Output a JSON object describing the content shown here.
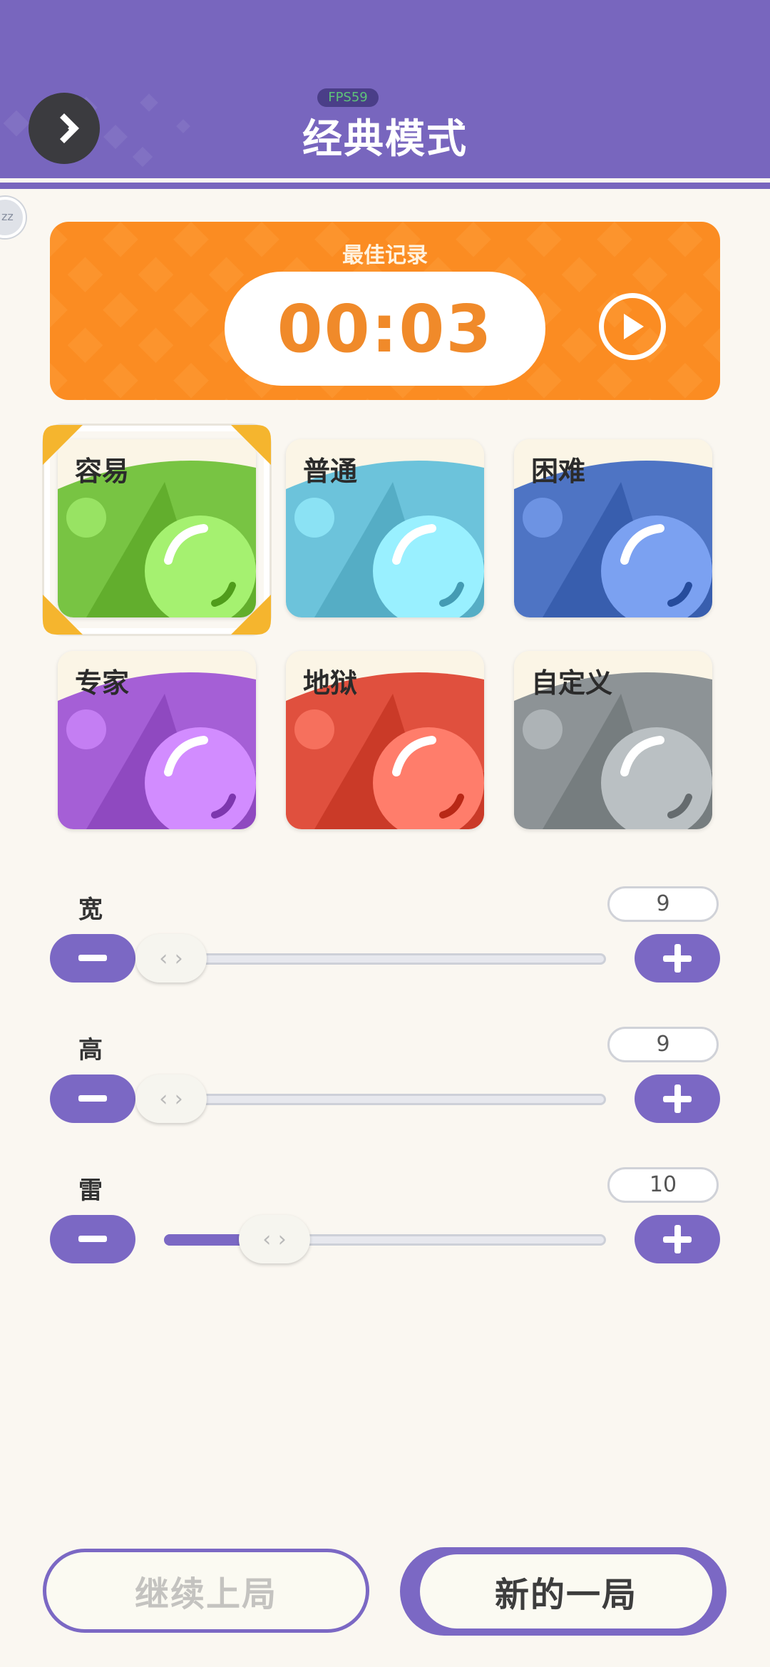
{
  "header": {
    "title": "经典模式",
    "fps_badge": "FPS59",
    "colors": {
      "background": "#7866be"
    }
  },
  "side_bubble": {
    "text": "zz"
  },
  "best_record": {
    "label": "最佳记录",
    "time": "00:03",
    "color": "#fb8c22"
  },
  "difficulties": [
    {
      "label": "容易",
      "selected": true,
      "color": "#78c443"
    },
    {
      "label": "普通",
      "selected": false,
      "color": "#6cc3db"
    },
    {
      "label": "困难",
      "selected": false,
      "color": "#4e74c4"
    },
    {
      "label": "专家",
      "selected": false,
      "color": "#a55fd6"
    },
    {
      "label": "地狱",
      "selected": false,
      "color": "#e0503e"
    },
    {
      "label": "自定义",
      "selected": false,
      "color": "#8d9396"
    }
  ],
  "sliders": {
    "width": {
      "label": "宽",
      "value": "9",
      "fraction": 0.0
    },
    "height": {
      "label": "高",
      "value": "9",
      "fraction": 0.0
    },
    "mines": {
      "label": "雷",
      "value": "10",
      "fraction": 0.25
    }
  },
  "buttons": {
    "continue": "继续上局",
    "new_game": "新的一局"
  },
  "accent": "#7b68c4"
}
